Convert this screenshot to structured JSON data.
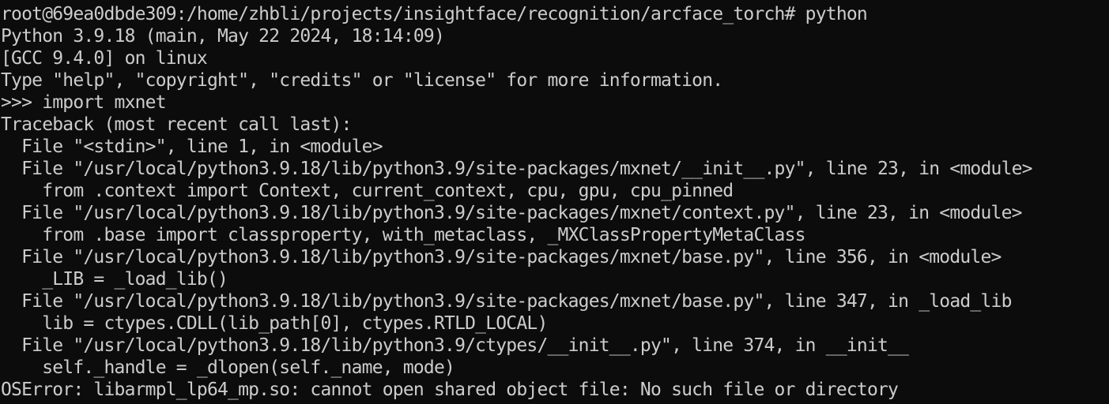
{
  "terminal": {
    "colors": {
      "background": "#0c0c0c",
      "foreground": "#cccccc"
    },
    "lines": [
      "root@69ea0dbde309:/home/zhbli/projects/insightface/recognition/arcface_torch# python",
      "Python 3.9.18 (main, May 22 2024, 18:14:09)",
      "[GCC 9.4.0] on linux",
      "Type \"help\", \"copyright\", \"credits\" or \"license\" for more information.",
      ">>> import mxnet",
      "Traceback (most recent call last):",
      "  File \"<stdin>\", line 1, in <module>",
      "  File \"/usr/local/python3.9.18/lib/python3.9/site-packages/mxnet/__init__.py\", line 23, in <module>",
      "    from .context import Context, current_context, cpu, gpu, cpu_pinned",
      "  File \"/usr/local/python3.9.18/lib/python3.9/site-packages/mxnet/context.py\", line 23, in <module>",
      "    from .base import classproperty, with_metaclass, _MXClassPropertyMetaClass",
      "  File \"/usr/local/python3.9.18/lib/python3.9/site-packages/mxnet/base.py\", line 356, in <module>",
      "    _LIB = _load_lib()",
      "  File \"/usr/local/python3.9.18/lib/python3.9/site-packages/mxnet/base.py\", line 347, in _load_lib",
      "    lib = ctypes.CDLL(lib_path[0], ctypes.RTLD_LOCAL)",
      "  File \"/usr/local/python3.9.18/lib/python3.9/ctypes/__init__.py\", line 374, in __init__",
      "    self._handle = _dlopen(self._name, mode)",
      "OSError: libarmpl_lp64_mp.so: cannot open shared object file: No such file or directory"
    ]
  }
}
